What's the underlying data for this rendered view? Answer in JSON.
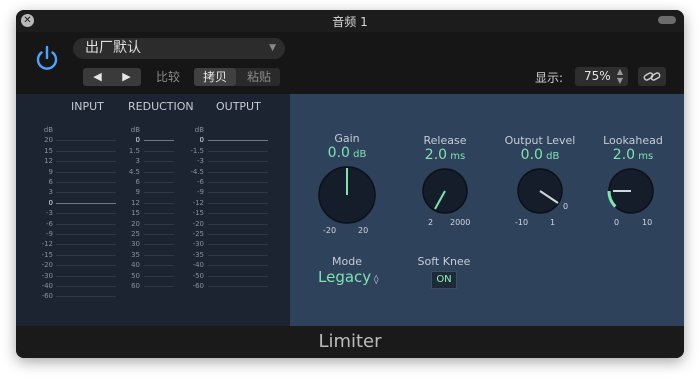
{
  "window": {
    "title": "音频 1"
  },
  "header": {
    "preset": "出厂默认",
    "compare_label": "比较",
    "copy_label": "拷贝",
    "paste_label": "粘贴",
    "view_label": "显示:",
    "zoom": "75%",
    "prev_label": "◀",
    "next_label": "▶"
  },
  "meters": {
    "input_label": "INPUT",
    "reduction_label": "REDUCTION",
    "output_label": "OUTPUT",
    "input_scale": [
      "dB",
      "20",
      "15",
      "12",
      "9",
      "6",
      "3",
      "0",
      "-3",
      "-6",
      "-9",
      "-12",
      "-15",
      "-20",
      "-30",
      "-40",
      "-60"
    ],
    "reduction_scale": [
      "dB",
      "0",
      "1.5",
      "3",
      "4.5",
      "6",
      "9",
      "12",
      "15",
      "20",
      "25",
      "30",
      "35",
      "40",
      "50",
      "60"
    ],
    "output_scale": [
      "dB",
      "0",
      "-1.5",
      "-3",
      "-4.5",
      "-6",
      "-9",
      "-12",
      "-15",
      "-20",
      "-25",
      "-30",
      "-35",
      "-40",
      "-50",
      "-60"
    ]
  },
  "params": {
    "gain": {
      "label": "Gain",
      "value": "0.0",
      "unit": "dB",
      "min": "-20",
      "max": "20",
      "level": 0.5
    },
    "release": {
      "label": "Release",
      "value": "2.0",
      "unit": "ms",
      "min": "2",
      "max": "2000",
      "level": 0.0
    },
    "output_level": {
      "label": "Output Level",
      "value": "0.0",
      "unit": "dB",
      "min": "-10",
      "max": "1",
      "zero": "0",
      "level": 0.91
    },
    "lookahead": {
      "label": "Lookahead",
      "value": "2.0",
      "unit": "ms",
      "min": "0",
      "max": "10",
      "level": 0.2
    },
    "mode": {
      "label": "Mode",
      "value": "Legacy"
    },
    "soft_knee": {
      "label": "Soft Knee",
      "value": "ON"
    }
  },
  "footer": {
    "title": "Limiter"
  },
  "colors": {
    "accent": "#7fe3b0",
    "power": "#4aa3ff",
    "params_bg": "#2f425b",
    "meters_bg": "#1c2431"
  }
}
